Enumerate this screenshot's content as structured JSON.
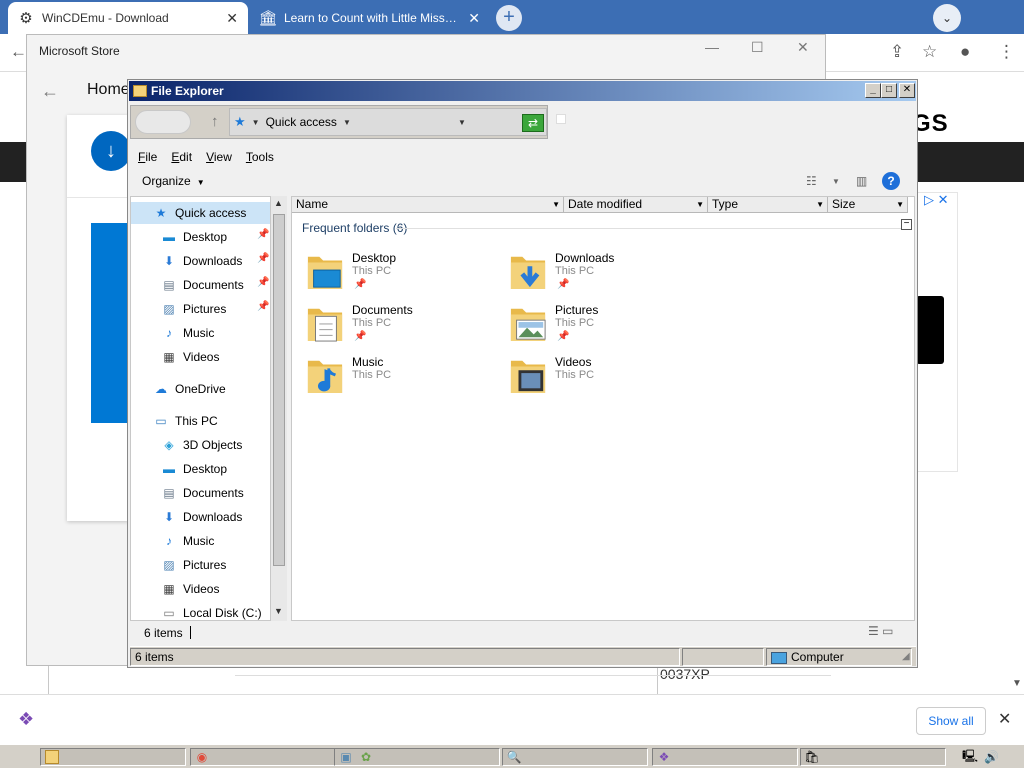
{
  "browser": {
    "tabs": [
      {
        "title": "WinCDEmu - Download",
        "favicon": "gear-icon"
      },
      {
        "title": "Learn to Count with Little Miss Brain",
        "favicon": "building-icon"
      }
    ],
    "page": {
      "logo_fragment": "GS",
      "text_fragment": "0037XP"
    },
    "download_bar": {
      "show_all_label": "Show all"
    }
  },
  "ms_store": {
    "title": "Microsoft Store",
    "nav_home": "Home"
  },
  "explorer": {
    "title": "File Explorer",
    "address": {
      "crumb": "Quick access"
    },
    "menu": [
      {
        "label": "File",
        "key": "F",
        "rest": "ile"
      },
      {
        "label": "Edit",
        "key": "E",
        "rest": "dit"
      },
      {
        "label": "View",
        "key": "V",
        "rest": "iew"
      },
      {
        "label": "Tools",
        "key": "T",
        "rest": "ools"
      }
    ],
    "organize_label": "Organize",
    "nav": [
      {
        "label": "Quick access",
        "icon": "star-icon",
        "pinned": false
      },
      {
        "label": "Desktop",
        "icon": "desktop-icon",
        "pinned": true
      },
      {
        "label": "Downloads",
        "icon": "download-icon",
        "pinned": true
      },
      {
        "label": "Documents",
        "icon": "document-icon",
        "pinned": true
      },
      {
        "label": "Pictures",
        "icon": "picture-icon",
        "pinned": true
      },
      {
        "label": "Music",
        "icon": "music-icon",
        "pinned": false
      },
      {
        "label": "Videos",
        "icon": "video-icon",
        "pinned": false
      },
      {
        "label": "OneDrive",
        "icon": "cloud-icon",
        "pinned": false
      },
      {
        "label": "This PC",
        "icon": "computer-icon",
        "pinned": false
      },
      {
        "label": "3D Objects",
        "icon": "cube-icon",
        "pinned": false
      },
      {
        "label": "Desktop",
        "icon": "desktop-icon",
        "pinned": false
      },
      {
        "label": "Documents",
        "icon": "document-icon",
        "pinned": false
      },
      {
        "label": "Downloads",
        "icon": "download-icon",
        "pinned": false
      },
      {
        "label": "Music",
        "icon": "music-icon",
        "pinned": false
      },
      {
        "label": "Pictures",
        "icon": "picture-icon",
        "pinned": false
      },
      {
        "label": "Videos",
        "icon": "video-icon",
        "pinned": false
      },
      {
        "label": "Local Disk (C:)",
        "icon": "disk-icon",
        "pinned": false
      }
    ],
    "columns": [
      "Name",
      "Date modified",
      "Type",
      "Size"
    ],
    "group_title": "Frequent folders (6)",
    "folders": [
      {
        "name": "Desktop",
        "location": "This PC",
        "pinned": true,
        "overlay": "desktop"
      },
      {
        "name": "Downloads",
        "location": "This PC",
        "pinned": true,
        "overlay": "download"
      },
      {
        "name": "Documents",
        "location": "This PC",
        "pinned": true,
        "overlay": "document"
      },
      {
        "name": "Pictures",
        "location": "This PC",
        "pinned": true,
        "overlay": "picture"
      },
      {
        "name": "Music",
        "location": "This PC",
        "pinned": false,
        "overlay": "music"
      },
      {
        "name": "Videos",
        "location": "This PC",
        "pinned": false,
        "overlay": "video"
      }
    ],
    "status_items": "6 items",
    "statusbar_items": "6 items",
    "statusbar_zone": "Computer"
  },
  "colors": {
    "chrome_tabbar": "#3c6eb4",
    "explorer_title_start": "#0a246a",
    "explorer_title_end": "#a6caf0",
    "folder_yellow": "#f3d27a",
    "accent_blue": "#1e7ad8"
  }
}
